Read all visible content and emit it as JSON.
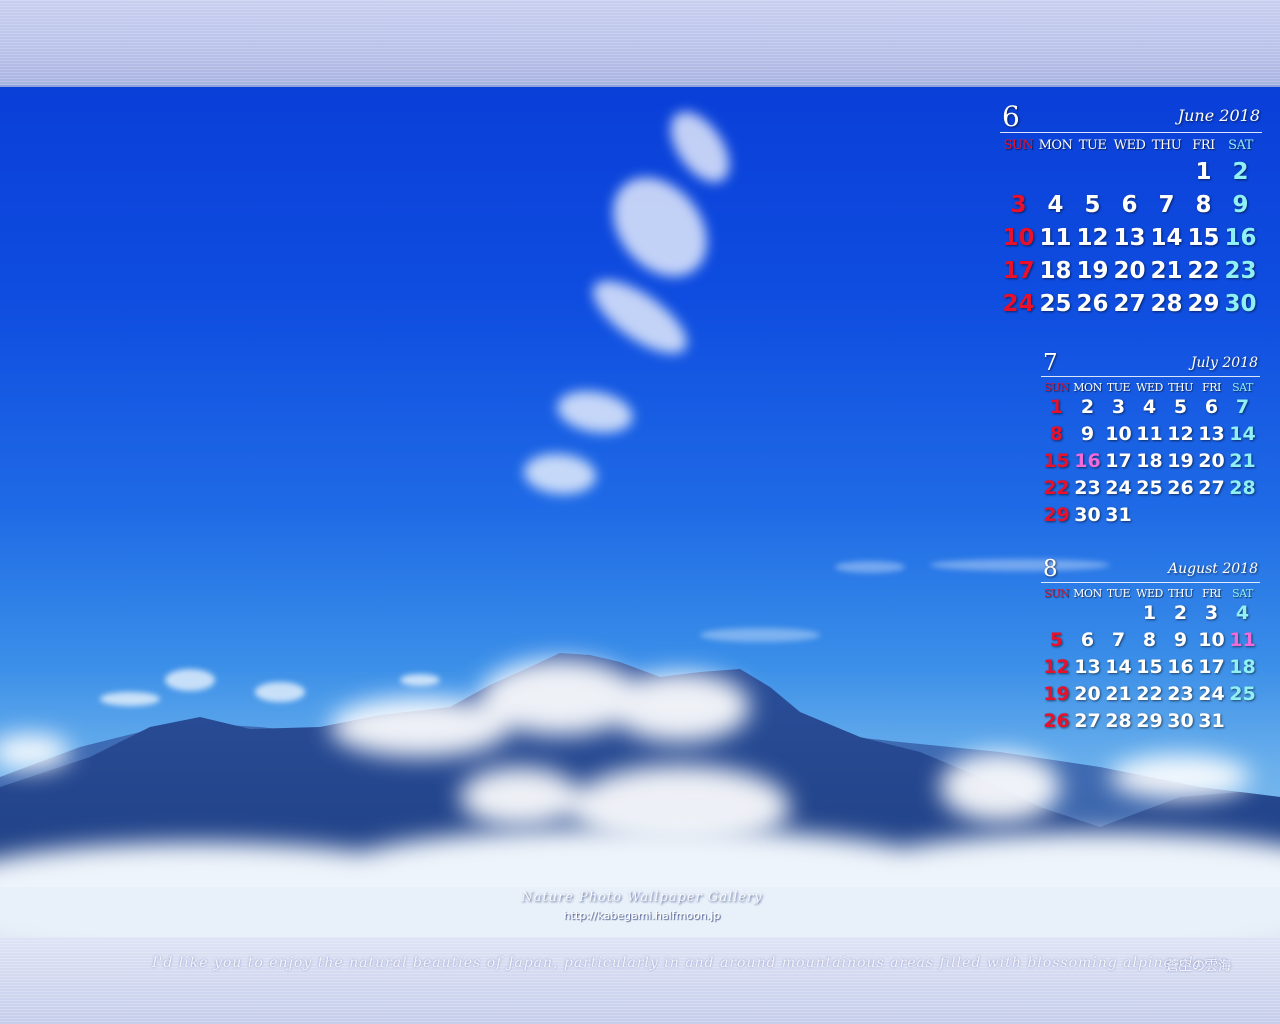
{
  "gallery": {
    "title": "Nature Photo Wallpaper Gallery",
    "url": "http://kabegami.halfmoon.jp"
  },
  "footer": {
    "tagline": "I'd like you to enjoy the natural beauties of Japan, particularly in and around mountainous areas filled with blossoming alpine plants.",
    "japanese_title": "蒼空の雲海"
  },
  "colors": {
    "sunday": "#e8102a",
    "saturday": "#8ff0f6",
    "holiday": "#f06ad8",
    "weekday": "#ffffff"
  },
  "weekdays": [
    "SUN",
    "MON",
    "TUE",
    "WED",
    "THU",
    "FRI",
    "SAT"
  ],
  "calendars": [
    {
      "month_number": "6",
      "month_name": "June 2018",
      "first_weekday": 5,
      "days_in_month": 30,
      "holidays": []
    },
    {
      "month_number": "7",
      "month_name": "July 2018",
      "first_weekday": 0,
      "days_in_month": 31,
      "holidays": [
        16
      ]
    },
    {
      "month_number": "8",
      "month_name": "August 2018",
      "first_weekday": 3,
      "days_in_month": 31,
      "holidays": [
        11
      ]
    }
  ]
}
